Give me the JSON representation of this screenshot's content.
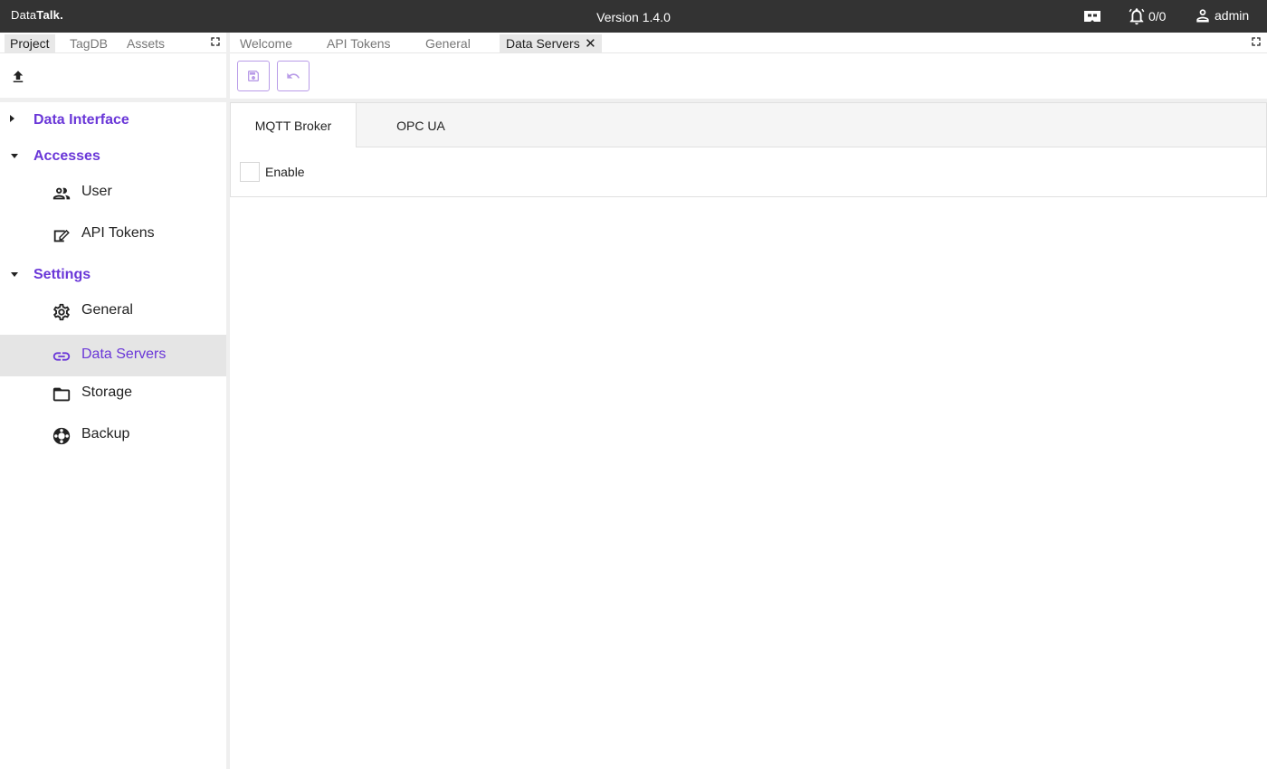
{
  "app": {
    "logo_prefix": "Data",
    "logo_bold": "Talk.",
    "version": "Version 1.4.0",
    "alarms": "0/0",
    "user": "admin"
  },
  "left_tabs": [
    "Project",
    "TagDB",
    "Assets"
  ],
  "tree": {
    "data_interface": "Data Interface",
    "accesses": "Accesses",
    "settings": "Settings",
    "user": "User",
    "api_tokens": "API Tokens",
    "general": "General",
    "data_servers": "Data Servers",
    "storage": "Storage",
    "backup": "Backup"
  },
  "right_tabs": [
    "Welcome",
    "API Tokens",
    "General",
    "Data Servers"
  ],
  "sub_tabs": [
    "MQTT Broker",
    "OPC UA"
  ],
  "enable_label": "Enable",
  "colors": {
    "accent": "#6a37d8",
    "topbar": "#333333"
  }
}
